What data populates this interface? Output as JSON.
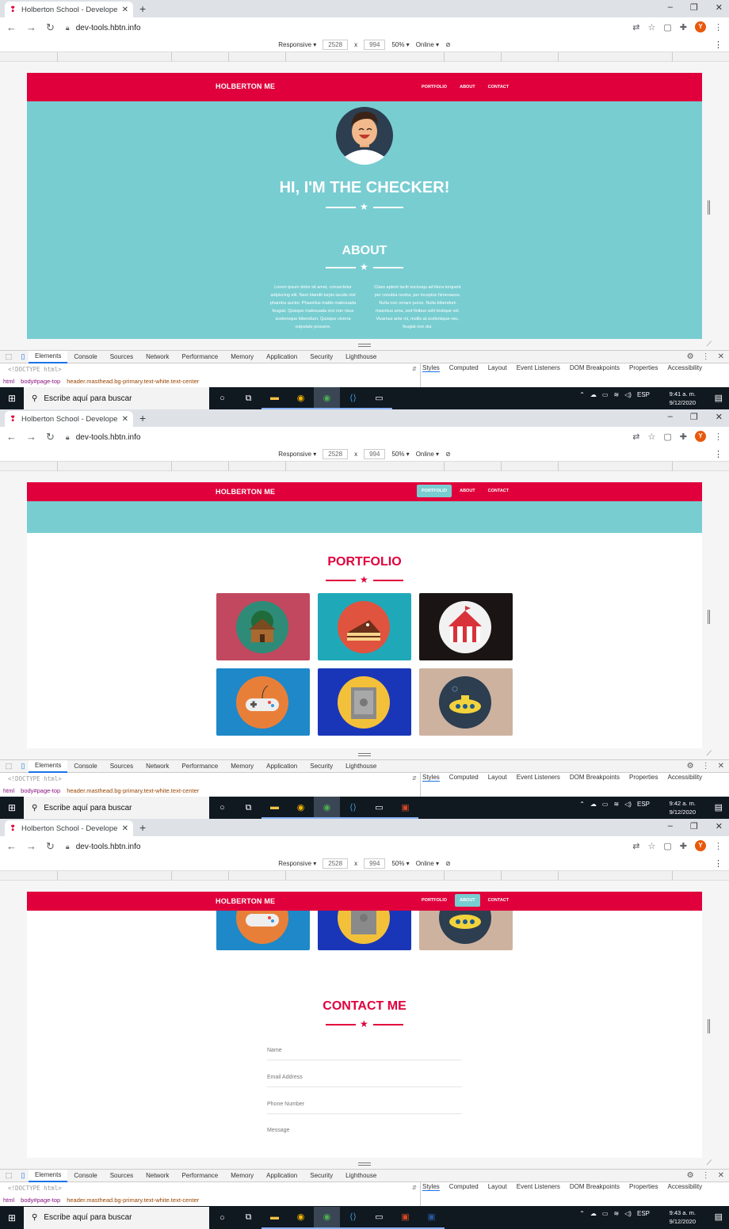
{
  "browser": {
    "tab_title": "Holberton School - Developer to",
    "url": "dev-tools.hbtn.info",
    "avatar_letter": "Y"
  },
  "device_toolbar": {
    "mode": "Responsive",
    "width": "2528",
    "x": "x",
    "height": "994",
    "zoom": "50%",
    "network": "Online"
  },
  "site": {
    "brand": "HOLBERTON ME",
    "nav": [
      "PORTFOLIO",
      "ABOUT",
      "CONTACT"
    ],
    "hero_title": "HI, I'M THE CHECKER!",
    "about_title": "ABOUT",
    "about_left": "Lorem ipsum dolor sit amet, consectetur adipiscing elit. Nam blandit turpis iaculis nisl pharetra auctor. Phasellus mattis malesuada feugiat. Quisque malesuada orci non risus scelerisque bibendum. Quisque viverra vulputate posuere.",
    "about_right": "Class aptent taciti sociosqu ad litora torquent per conubia nostra, per inceptos himenaeos. Nulla non ornare purus. Nulla bibendum maximus urna, sed finibus velit tristique vel. Vivamus ante mi, mollis at scelerisque nec, feugiat non dui.",
    "portfolio_title": "PORTFOLIO",
    "portfolio_items": [
      "cabin",
      "cake",
      "circus",
      "game",
      "safe",
      "submarine"
    ],
    "contact_title": "CONTACT ME",
    "contact_fields": [
      "Name",
      "Email Address",
      "Phone Number",
      "Message"
    ]
  },
  "devtools": {
    "tabs": [
      "Elements",
      "Console",
      "Sources",
      "Network",
      "Performance",
      "Memory",
      "Application",
      "Security",
      "Lighthouse"
    ],
    "doctype": "<!DOCTYPE html>",
    "breadcrumbs": [
      "html",
      "body#page-top",
      "header.masthead.bg-primary.text-white.text-center"
    ],
    "side_tabs": [
      "Styles",
      "Computed",
      "Layout",
      "Event Listeners",
      "DOM Breakpoints",
      "Properties",
      "Accessibility"
    ]
  },
  "taskbar": {
    "search_placeholder": "Escribe aquí para buscar",
    "language": "ESP",
    "times": [
      "9:41 a. m.",
      "9:42 a. m.",
      "9:43 a. m."
    ],
    "date": "9/12/2020",
    "notifications": "12"
  },
  "colors": {
    "primary": "#e0003c",
    "secondary": "#78cdd1",
    "taskbar": "#101820"
  }
}
